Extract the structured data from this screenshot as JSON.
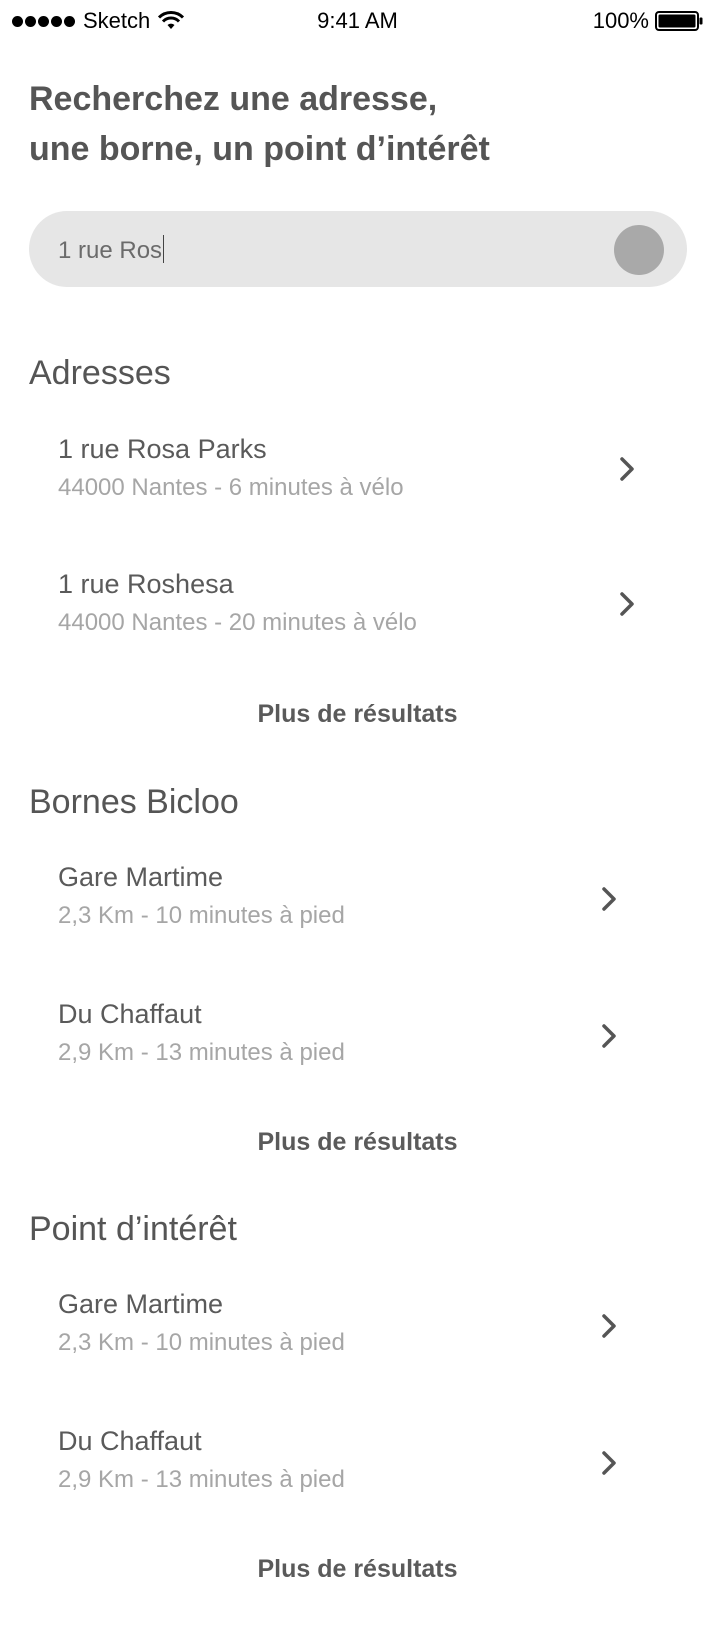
{
  "status_bar": {
    "carrier": "Sketch",
    "time": "9:41 AM",
    "battery": "100%"
  },
  "header": {
    "title_line1": "Recherchez une adresse,",
    "title_line2": "une borne, un point d’intérêt"
  },
  "search": {
    "value": "1 rue Ros"
  },
  "sections": {
    "addresses": {
      "title": "Adresses",
      "items": [
        {
          "title": "1 rue Rosa Parks",
          "subtitle": "44000 Nantes - 6 minutes à vélo"
        },
        {
          "title": "1 rue Roshesa",
          "subtitle": "44000 Nantes - 20 minutes à vélo"
        }
      ],
      "more": "Plus de résultats"
    },
    "stations": {
      "title": "Bornes Bicloo",
      "items": [
        {
          "title": "Gare Martime",
          "subtitle": "2,3 Km - 10 minutes à pied"
        },
        {
          "title": "Du Chaffaut",
          "subtitle": "2,9 Km - 13 minutes à pied"
        }
      ],
      "more": "Plus de résultats"
    },
    "poi": {
      "title": "Point d’intérêt",
      "items": [
        {
          "title": "Gare Martime",
          "subtitle": "2,3 Km - 10 minutes à pied"
        },
        {
          "title": "Du Chaffaut",
          "subtitle": "2,9 Km - 13 minutes à pied"
        }
      ],
      "more": "Plus de résultats"
    }
  },
  "icons": {
    "chevron": "chevron-right-icon",
    "clear": "clear-search-icon",
    "wifi": "wifi-icon",
    "battery": "battery-icon"
  }
}
